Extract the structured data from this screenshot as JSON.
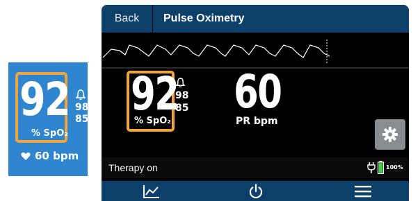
{
  "tile": {
    "spo2_value": "92",
    "spo2_high": "98",
    "spo2_low": "85",
    "spo2_unit": "% SpO₂",
    "pr_text": "60 bpm"
  },
  "header": {
    "back_label": "Back",
    "title": "Pulse Oximetry"
  },
  "vitals": {
    "spo2_value": "92",
    "spo2_high": "98",
    "spo2_low": "85",
    "spo2_unit": "% SpO₂",
    "pr_value": "60",
    "pr_unit": "PR bpm"
  },
  "status": {
    "text": "Therapy on",
    "battery_percent": "100%"
  },
  "icons": {
    "alarm": "bell-icon",
    "heart": "heart-icon",
    "settings": "gear-icon",
    "power_source": "plug-icon",
    "battery": "battery-icon",
    "trend": "trend-chart-icon",
    "power": "power-icon",
    "menu": "hamburger-menu-icon"
  },
  "colors": {
    "header_bg": "#0d3f6b",
    "tile_bg": "#2f86cf",
    "highlight": "#f3a43f",
    "battery_green": "#3fd13f",
    "settings_bg": "#8a8d90"
  }
}
